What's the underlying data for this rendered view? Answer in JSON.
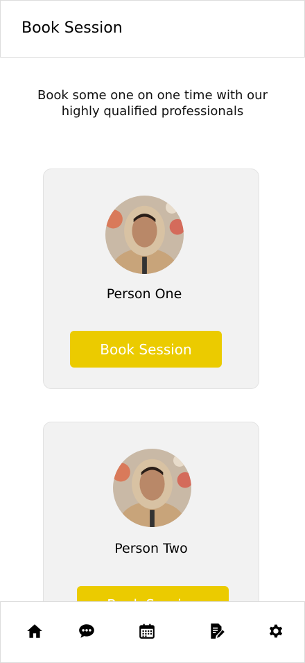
{
  "header": {
    "title": "Book Session"
  },
  "intro": {
    "text": "Book some one on one time with our highly qualified professionals"
  },
  "professionals": [
    {
      "name": "Person One",
      "button_label": "Book Session"
    },
    {
      "name": "Person Two",
      "button_label": "Book Session"
    }
  ],
  "tabbar": {
    "icons": [
      "home-icon",
      "chat-icon",
      "calendar-icon",
      "notes-edit-icon",
      "gear-icon"
    ]
  },
  "colors": {
    "accent": "#ebcb00",
    "card_bg": "#f2f2f2"
  }
}
